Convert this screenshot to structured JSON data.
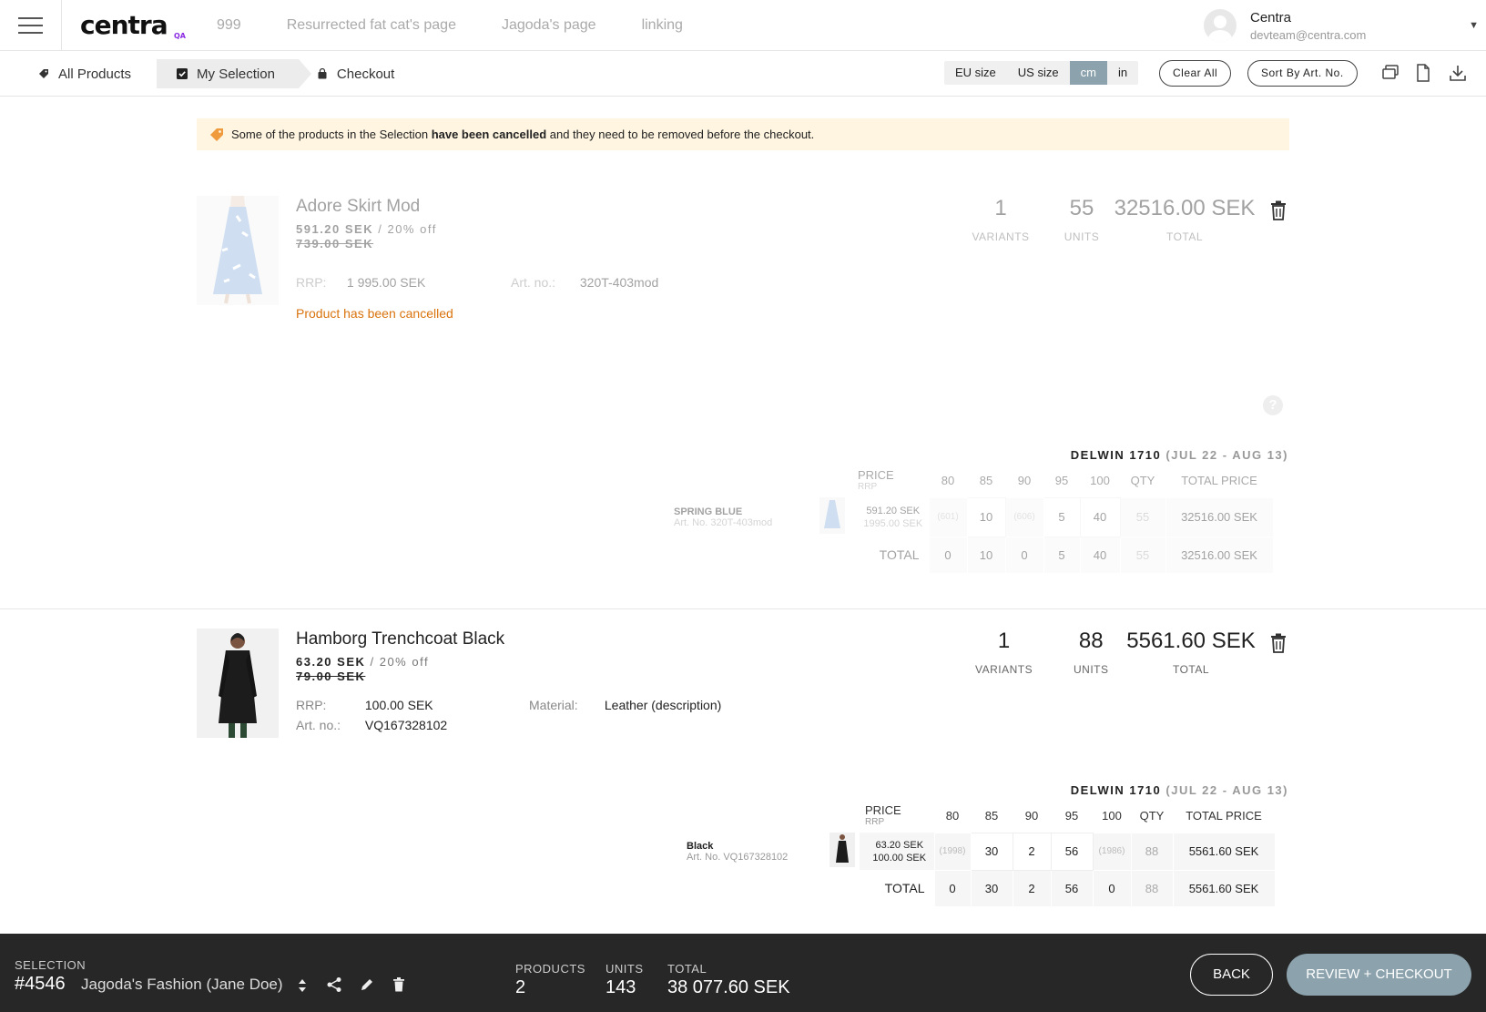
{
  "header": {
    "logo_text": "centra",
    "logo_badge": "QA",
    "nav": [
      "999",
      "Resurrected fat cat's page",
      "Jagoda's page",
      "linking"
    ],
    "user_name": "Centra",
    "user_email": "devteam@centra.com"
  },
  "steps": {
    "all_products": "All Products",
    "my_selection": "My Selection",
    "checkout": "Checkout"
  },
  "units": {
    "eu": "EU size",
    "us": "US size",
    "cm": "cm",
    "in": "in",
    "selected": "cm"
  },
  "toolbar": {
    "clear_all": "Clear All",
    "sort": "Sort By Art. No."
  },
  "alert": {
    "pre": "Some of the products in the Selection ",
    "bold": "have been cancelled",
    "post": " and they need to be removed before the checkout."
  },
  "products": [
    {
      "name": "Adore Skirt Mod",
      "price": "591.20 SEK",
      "discount": "/ 20% off",
      "was": "739.00 SEK",
      "rrp_label": "RRP:",
      "rrp": "1 995.00 SEK",
      "art_label": "Art. no.:",
      "art": "320T-403mod",
      "cancel_msg": "Product has been cancelled",
      "variants": "1",
      "units": "55",
      "total": "32516.00 SEK",
      "variants_label": "VARIANTS",
      "units_label": "UNITS",
      "total_label": "TOTAL",
      "help": "?",
      "drop": "DELWIN 1710",
      "drop_dates": "(JUL 22 - AUG 13)",
      "price_head": "PRICE",
      "rrp_head": "RRP",
      "sizes": [
        "80",
        "85",
        "90",
        "95",
        "100"
      ],
      "qty_head": "QTY",
      "total_price_head": "TOTAL PRICE",
      "variant_name": "SPRING BLUE",
      "variant_art": "Art. No. 320T-403mod",
      "variant_price": "591.20 SEK",
      "variant_rrp": "1995.00 SEK",
      "row": [
        "(601)",
        "10",
        "(606)",
        "5",
        "40"
      ],
      "row_qty": "55",
      "row_total": "32516.00 SEK",
      "total_row_label": "TOTAL",
      "totals": [
        "0",
        "10",
        "0",
        "5",
        "40"
      ],
      "totals_qty": "55",
      "totals_total": "32516.00 SEK"
    },
    {
      "name": "Hamborg Trenchcoat Black",
      "price": "63.20 SEK",
      "discount": "/ 20% off",
      "was": "79.00 SEK",
      "rrp_label": "RRP:",
      "rrp": "100.00 SEK",
      "art_label": "Art. no.:",
      "art": "VQ167328102",
      "material_label": "Material:",
      "material": "Leather (description)",
      "variants": "1",
      "units": "88",
      "total": "5561.60 SEK",
      "variants_label": "VARIANTS",
      "units_label": "UNITS",
      "total_label": "TOTAL",
      "drop": "DELWIN 1710",
      "drop_dates": "(JUL 22 - AUG 13)",
      "price_head": "PRICE",
      "rrp_head": "RRP",
      "sizes": [
        "80",
        "85",
        "90",
        "95",
        "100"
      ],
      "qty_head": "QTY",
      "total_price_head": "TOTAL PRICE",
      "variant_name": "Black",
      "variant_art": "Art. No. VQ167328102",
      "variant_price": "63.20 SEK",
      "variant_rrp": "100.00 SEK",
      "row": [
        "(1998)",
        "30",
        "2",
        "56",
        "(1986)"
      ],
      "row_qty": "88",
      "row_total": "5561.60 SEK",
      "total_row_label": "TOTAL",
      "totals": [
        "0",
        "30",
        "2",
        "56",
        "0"
      ],
      "totals_qty": "88",
      "totals_total": "5561.60 SEK"
    }
  ],
  "footer": {
    "selection_label": "SELECTION",
    "selection_id": "#4546",
    "selection_name": "Jagoda's Fashion (Jane Doe)",
    "products_label": "PRODUCTS",
    "products": "2",
    "units_label": "UNITS",
    "units": "143",
    "total_label": "TOTAL",
    "total": "38 077.60 SEK",
    "back": "BACK",
    "review": "REVIEW + CHECKOUT"
  },
  "colors": {
    "accent": "#8ca3ae",
    "warning_bg": "#fff5e0",
    "cancel_text": "#d9730d",
    "footer_bg": "#272727"
  }
}
